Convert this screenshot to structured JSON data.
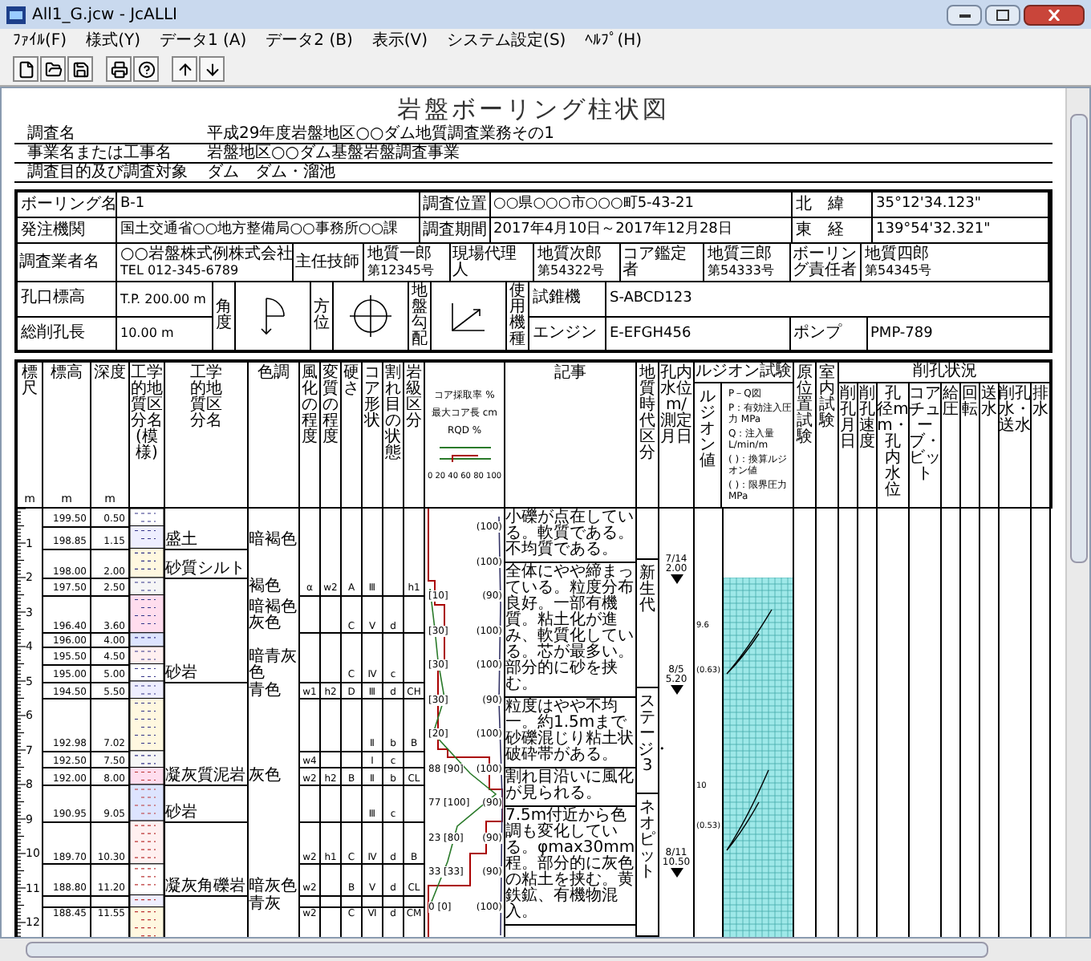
{
  "window": {
    "title": "All1_G.jcw - JcALLI"
  },
  "menu": [
    "ﾌｧｲﾙ(F)",
    "様式(Y)",
    "データ1 (A)",
    "データ2 (B)",
    "表示(V)",
    "システム設定(S)",
    "ﾍﾙﾌﾟ(H)"
  ],
  "document": {
    "title": "岩盤ボーリング柱状図",
    "info_lines": [
      {
        "label": "調査名",
        "value": "平成29年度岩盤地区○○ダム地質調査業務その1"
      },
      {
        "label": "事業名または工事名",
        "value": "岩盤地区○○ダム基盤岩盤調査事業"
      },
      {
        "label": "調査目的及び調査対象",
        "value": "ダム　ダム・溜池"
      }
    ],
    "header_rows": [
      [
        {
          "label": "ボーリング名",
          "value": "B-1"
        },
        {
          "label": "調査位置",
          "value": "○○県○○○市○○○町5-43-21"
        },
        {
          "label": "北　緯",
          "value": "35°12'34.123\""
        }
      ],
      [
        {
          "label": "発注機関",
          "value": "国土交通省○○地方整備局○○事務所○○課"
        },
        {
          "label": "調査期間",
          "value": "2017年4月10日～2017年12月28日"
        },
        {
          "label": "東　経",
          "value": "139°54'32.321\""
        }
      ],
      [
        {
          "label": "調査業者名",
          "value": "○○岩盤株式例株式会社",
          "sub_value": "TEL 012-345-6789"
        },
        {
          "label": "主任技師",
          "value": "地質一郎",
          "sub_value": "第12345号"
        },
        {
          "label": "現場代理人",
          "value": "地質次郎",
          "sub_value": "第54322号"
        },
        {
          "label": "コア鑑定者",
          "value": "地質三郎",
          "sub_value": "第54333号"
        },
        {
          "label": "ボーリング責任者",
          "value": "地質四郎",
          "sub_value": "第54345号"
        }
      ]
    ],
    "site_rows": [
      {
        "label": "孔口標高",
        "value": "T.P. 200.00 m"
      },
      {
        "label": "総削孔長",
        "value": "10.00 m"
      }
    ],
    "diagrams": [
      {
        "kind": "angle",
        "label": "角度"
      },
      {
        "kind": "bearing",
        "label": "方位"
      },
      {
        "kind": "slope",
        "label": "地盤勾配"
      }
    ],
    "machine_label": "使用機種",
    "machines": [
      [
        {
          "label": "試錐機",
          "value": "S-ABCD123"
        }
      ],
      [
        {
          "label": "エンジン",
          "value": "E-EFGH456"
        },
        {
          "label": "ポンプ",
          "value": "PMP-789"
        }
      ]
    ]
  },
  "log": {
    "columns": [
      {
        "kind": "scale",
        "label": "標尺",
        "unit": "m"
      },
      {
        "kind": "elevation",
        "label": "標高",
        "unit": "m"
      },
      {
        "kind": "depth",
        "label": "深度",
        "unit": "m"
      },
      {
        "kind": "pattern",
        "label": "工学的地質区分名(模様)"
      },
      {
        "kind": "name",
        "label": "工学的地質区分名"
      },
      {
        "kind": "tint",
        "label": "色調"
      },
      {
        "kind": "weathering",
        "label": "風化の程度"
      },
      {
        "kind": "alteration",
        "label": "変質の程度"
      },
      {
        "kind": "hardness",
        "label": "硬さ"
      },
      {
        "kind": "core_shape",
        "label": "コア形状"
      },
      {
        "kind": "fracture",
        "label": "割れ目の状態"
      },
      {
        "kind": "rock_class",
        "label": "岩級区分"
      },
      {
        "kind": "core",
        "lines": [
          "コア採取率 %",
          "最大コア長 cm",
          "RQD %"
        ],
        "ticks": "0 20 40 60 80 100"
      },
      {
        "kind": "remarks",
        "label": "記事"
      },
      {
        "kind": "age",
        "label": "地質時代区分"
      },
      {
        "kind": "water",
        "label": "孔内水位m/測定月日"
      },
      {
        "kind": "lugeon",
        "label": "ルジオン試験",
        "value_label": "ルジオン値",
        "legend": [
          "P－Q図",
          "P：有効注入圧力 MPa",
          "Q：注入量 L/min/m",
          "( )：換算ルジオン値",
          "( )：限界圧力 MPa"
        ]
      },
      {
        "kind": "insitu",
        "label": "原位置試験"
      },
      {
        "kind": "lab",
        "label": "室内試験"
      },
      {
        "kind": "drilling",
        "label": "削孔状況",
        "subs": [
          "削孔月日",
          "削孔速度",
          "孔径mm・孔内水位",
          "コアチューブ・ビット",
          "給圧",
          "回転",
          "送水",
          "削孔水・送水",
          "排水"
        ]
      }
    ],
    "scale_labels": [
      "1",
      "2",
      "3",
      "4",
      "5",
      "6",
      "7",
      "8",
      "9",
      "10",
      "11",
      "12"
    ],
    "layers": [
      {
        "elevation": "199.50",
        "depth": "0.50"
      },
      {
        "elevation": "198.85",
        "depth": "1.15",
        "name": "盛土",
        "tint": "暗褐色"
      },
      {
        "elevation": "198.00",
        "depth": "2.00",
        "name": "砂質シルト"
      },
      {
        "elevation": "197.50",
        "depth": "2.50",
        "tint": "褐色",
        "codes": {
          "weathering": "α",
          "alteration": "w2",
          "hardness": "A",
          "core_shape": "Ⅲ",
          "rock_class": "h1"
        }
      },
      {
        "elevation": "196.40",
        "depth": "3.60",
        "tint": "暗褐色灰色",
        "codes": {
          "hardness": "C",
          "core_shape": "Ⅴ",
          "fracture": "d"
        }
      },
      {
        "elevation": "196.00",
        "depth": "4.00"
      },
      {
        "elevation": "195.50",
        "depth": "4.50"
      },
      {
        "elevation": "195.00",
        "depth": "5.00",
        "name": "砂岩",
        "tint": "暗青灰色",
        "codes": {
          "hardness": "C",
          "core_shape": "Ⅳ",
          "fracture": "c"
        }
      },
      {
        "elevation": "194.50",
        "depth": "5.50",
        "tint": "青色",
        "codes": {
          "weathering": "w1",
          "alteration": "h2",
          "hardness": "D",
          "core_shape": "Ⅲ",
          "fracture": "d",
          "rock_class": "CH"
        }
      },
      {
        "elevation": "192.98",
        "depth": "7.02",
        "codes": {
          "core_shape": "Ⅱ",
          "fracture": "b",
          "rock_class": "B"
        }
      },
      {
        "elevation": "192.50",
        "depth": "7.50",
        "codes": {
          "weathering": "w4",
          "core_shape": "Ⅰ",
          "fracture": "c"
        }
      },
      {
        "elevation": "192.00",
        "depth": "8.00",
        "name": "凝灰質泥岩",
        "tint": "灰色",
        "codes": {
          "weathering": "w2",
          "alteration": "h2",
          "hardness": "B",
          "core_shape": "Ⅱ",
          "fracture": "b",
          "rock_class": "CL"
        }
      },
      {
        "elevation": "190.95",
        "depth": "9.05",
        "name": "砂岩",
        "codes": {
          "core_shape": "Ⅲ",
          "fracture": "c"
        }
      },
      {
        "elevation": "189.70",
        "depth": "10.30",
        "codes": {
          "weathering": "w2",
          "alteration": "h1",
          "hardness": "C",
          "core_shape": "Ⅳ",
          "fracture": "d",
          "rock_class": "B"
        }
      },
      {
        "elevation": "188.80",
        "depth": "11.20",
        "name": "凝灰角礫岩",
        "tint": "暗灰色",
        "codes": {
          "weathering": "w2",
          "hardness": "B",
          "core_shape": "Ⅴ",
          "fracture": "d",
          "rock_class": "CL"
        }
      },
      {
        "elevation": "188.45",
        "depth": "11.55",
        "tint": "青灰",
        "codes": {
          "weathering": "w2",
          "hardness": "C",
          "core_shape": "Ⅵ",
          "fracture": "d",
          "rock_class": "CM"
        }
      }
    ],
    "core_rows": [
      [
        "",
        "(100)"
      ],
      [
        "",
        "(100)"
      ],
      [
        "[10]",
        "(90)"
      ],
      [
        "[30]",
        "(100)"
      ],
      [
        "[30]",
        "(100)"
      ],
      [
        "[30]",
        "(90)"
      ],
      [
        "[20]",
        "(100)"
      ],
      [
        "88 [90]",
        "(100)"
      ],
      [
        "77 [100]",
        "(90)"
      ],
      [
        "23 [80]",
        "(90)"
      ],
      [
        "33 [33]",
        "(90)"
      ],
      [
        "0 [0]",
        "(100)"
      ]
    ],
    "remarks": [
      "小礫が点在している。軟質である。不均質である。",
      "全体にやや締まっている。粒度分布良好。一部有機質。粘土化が進み、軟質化している。芯が最多い。部分的に砂を挟む。",
      "粒度はやや不均一。約1.5mまで砂礫混じり粘土状破砕帯がある。",
      "割れ目沿いに風化が見られる。",
      "7.5m付近から色調も変化している。φmax30mm程。部分的に灰色の粘土を挟む。黄鉄鉱、有機物混入。"
    ],
    "ages": [
      "新生代",
      "ステージ・3",
      "ネオピット"
    ],
    "water_levels": [
      {
        "date": "7/14",
        "level_m": "2.00"
      },
      {
        "date": "8/5",
        "level_m": "5.20"
      },
      {
        "date": "8/11",
        "level_m": "10.50"
      }
    ],
    "lugeon_values": [
      "9.6",
      "(0.63)",
      "10",
      "(0.53)"
    ]
  }
}
